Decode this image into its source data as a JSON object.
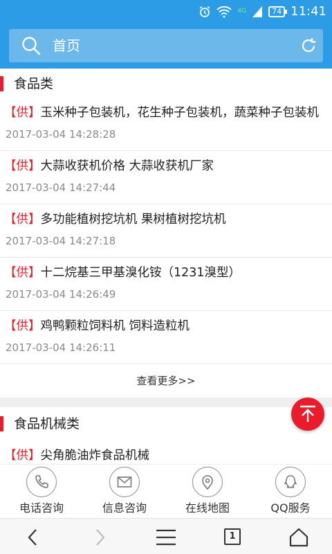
{
  "status": {
    "network": "4G",
    "battery": "74",
    "time": "11:41"
  },
  "header": {
    "title": "首页"
  },
  "sections": [
    {
      "title": "食品类",
      "items": [
        {
          "tag": "【供】",
          "title": "玉米种子包装机，花生种子包装机，蔬菜种子包装机",
          "date": "2017-03-04 14:28:28"
        },
        {
          "tag": "【供】",
          "title": "大蒜收获机价格 大蒜收获机厂家",
          "date": "2017-03-04 14:27:44"
        },
        {
          "tag": "【供】",
          "title": "多功能植树挖坑机 果树植树挖坑机",
          "date": "2017-03-04 14:27:18"
        },
        {
          "tag": "【供】",
          "title": "十二烷基三甲基溴化铵（1231溴型）",
          "date": "2017-03-04 14:26:49"
        },
        {
          "tag": "【供】",
          "title": "鸡鸭颗粒饲料机 饲料造粒机",
          "date": "2017-03-04 14:26:11"
        }
      ],
      "more_label": "查看更多>>"
    },
    {
      "title": "食品机械类",
      "items": [
        {
          "tag": "【供】",
          "title": "尖角脆油炸食品机械"
        }
      ]
    }
  ],
  "contact": [
    {
      "label": "电话咨询",
      "icon": "phone-icon"
    },
    {
      "label": "信息咨询",
      "icon": "mail-icon"
    },
    {
      "label": "在线地图",
      "icon": "map-pin-icon"
    },
    {
      "label": "QQ服务",
      "icon": "qq-icon"
    }
  ],
  "browser": {
    "tab_count": "1"
  },
  "colors": {
    "primary": "#2b9ce5",
    "accent": "#e81c2a"
  }
}
